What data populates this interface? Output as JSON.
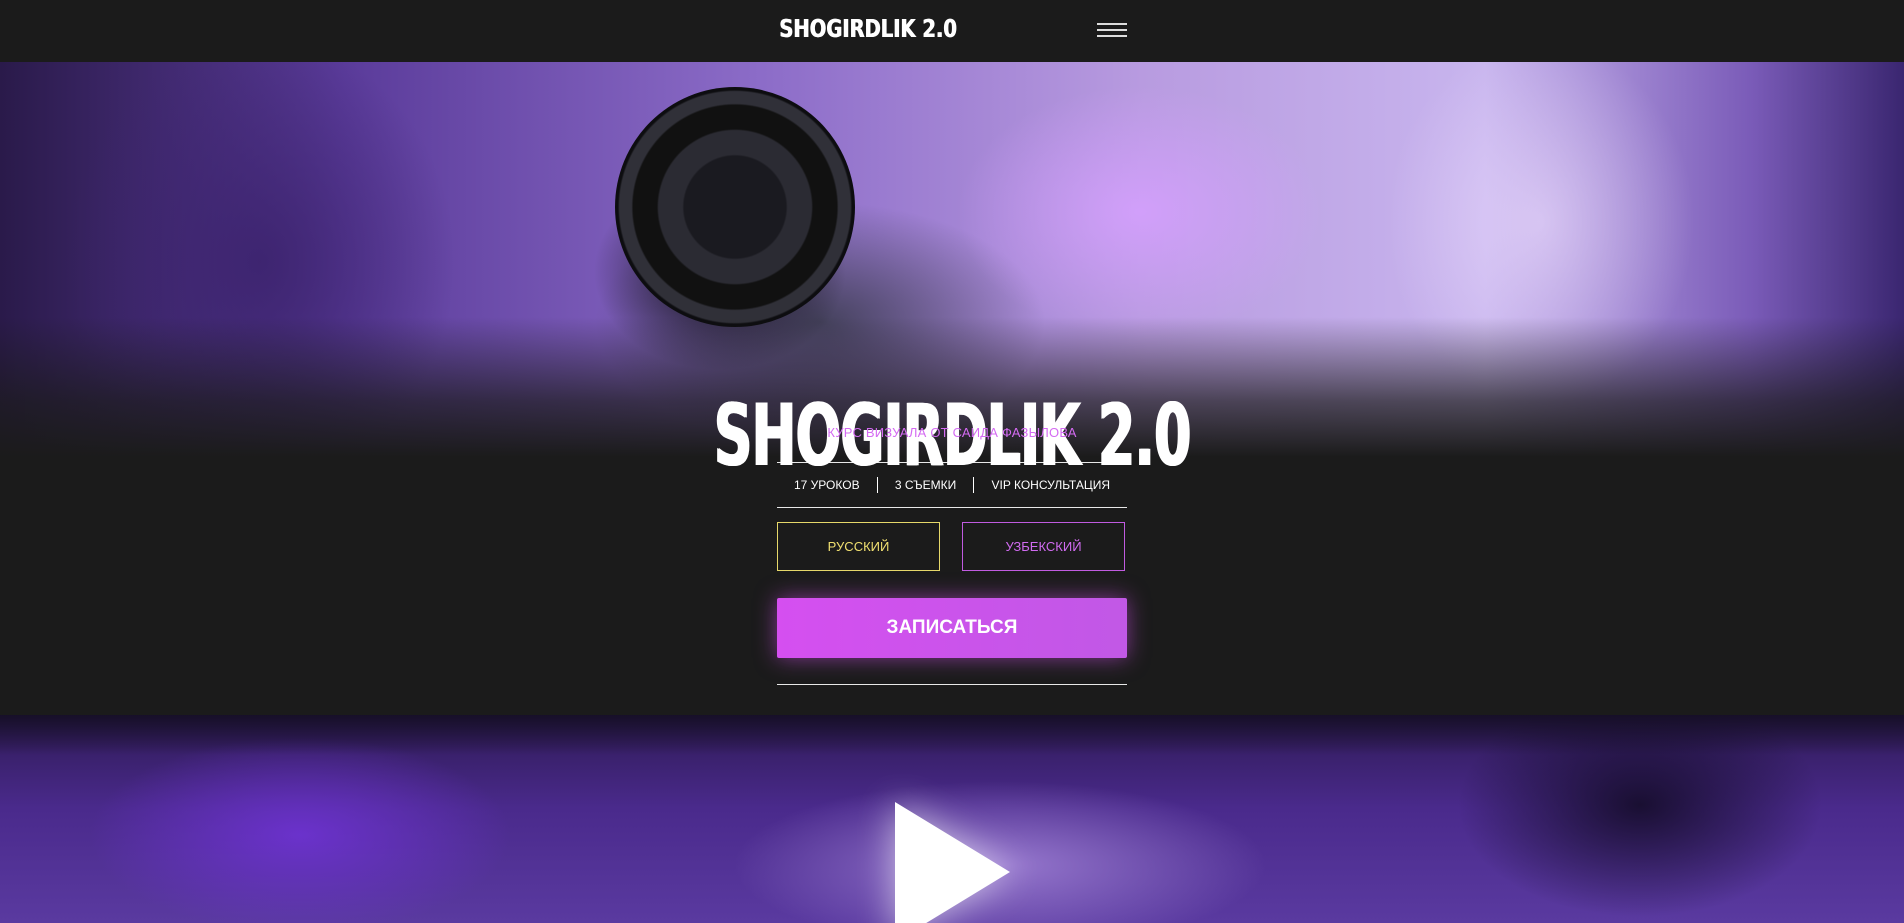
{
  "header": {
    "logo": "SHOGIRDLIK 2.0",
    "menu_icon": "hamburger-menu-icon"
  },
  "hero": {
    "title": "SHOGIRDLIK 2.0",
    "subtitle": "КУРС ВИЗУАЛА ОТ САИДА ФАЗЫЛОВА",
    "features": [
      "17 УРОКОВ",
      "3 СЪЕМКИ",
      "VIP КОНСУЛЬТАЦИЯ"
    ],
    "languages": {
      "russian": "РУССКИЙ",
      "uzbek": "УЗБЕКСКИЙ"
    },
    "cta_label": "ЗАПИСАТЬСЯ"
  },
  "video": {
    "play_icon": "play-icon"
  },
  "colors": {
    "background": "#1b1b1b",
    "accent_purple": "#d54ff0",
    "accent_yellow": "#f0e070"
  }
}
